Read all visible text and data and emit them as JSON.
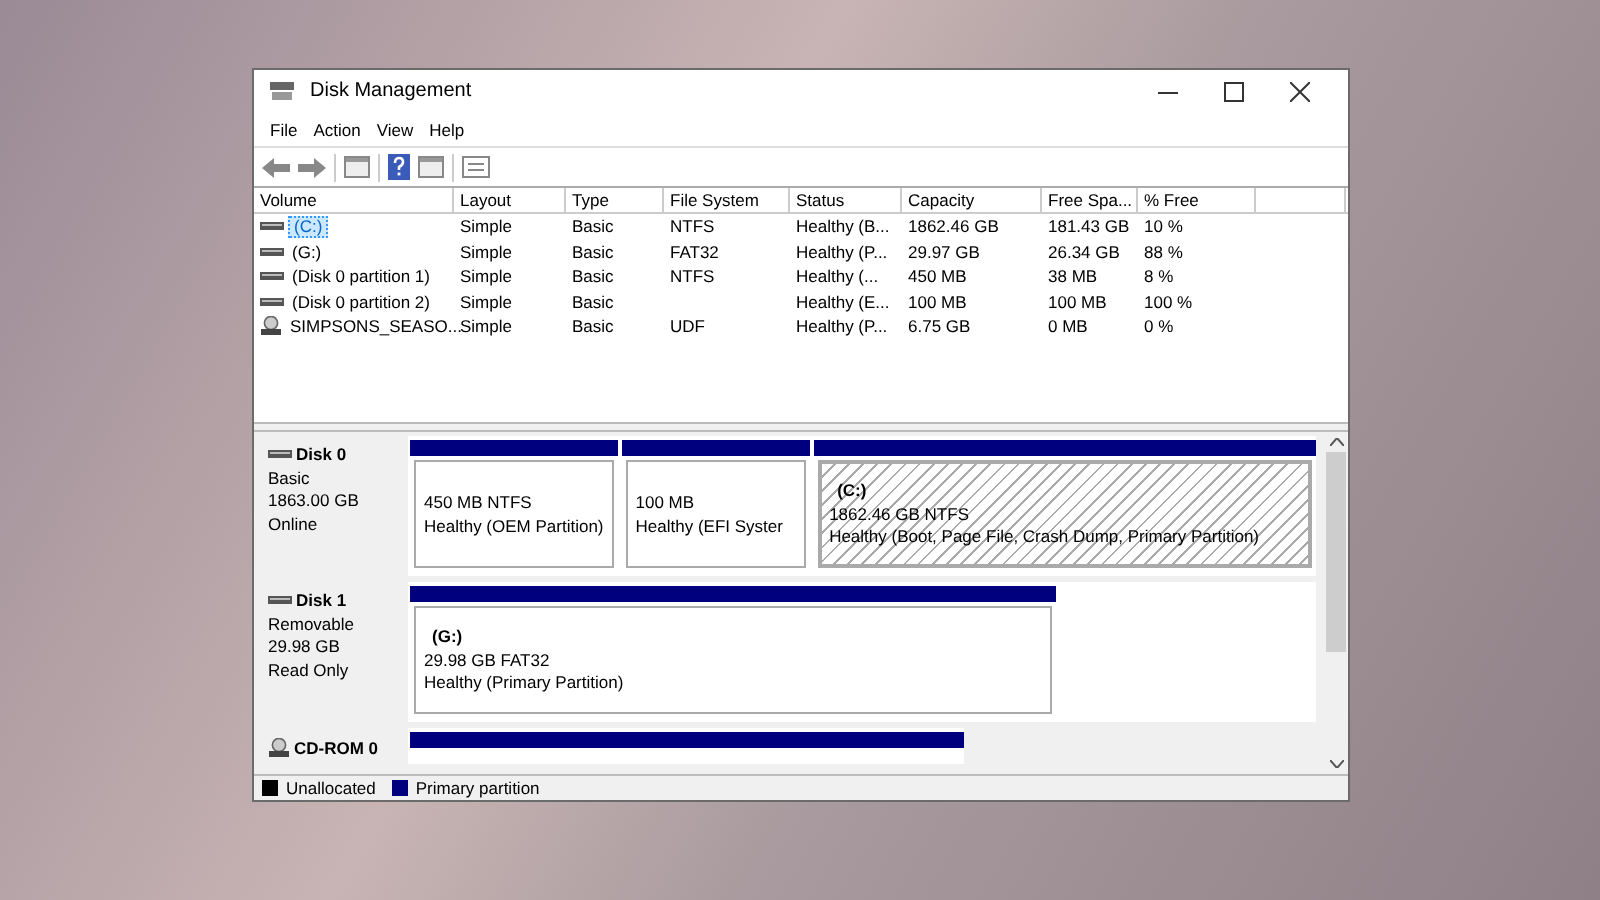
{
  "window": {
    "title": "Disk Management"
  },
  "menu": [
    "File",
    "Action",
    "View",
    "Help"
  ],
  "table": {
    "columns": [
      "Volume",
      "Layout",
      "Type",
      "File System",
      "Status",
      "Capacity",
      "Free Spa...",
      "% Free"
    ],
    "rows": [
      {
        "kind": "disk",
        "selected": true,
        "cells": [
          "(C:)",
          "Simple",
          "Basic",
          "NTFS",
          "Healthy (B...",
          "1862.46 GB",
          "181.43 GB",
          "10 %"
        ]
      },
      {
        "kind": "disk",
        "selected": false,
        "cells": [
          "(G:)",
          "Simple",
          "Basic",
          "FAT32",
          "Healthy (P...",
          "29.97 GB",
          "26.34 GB",
          "88 %"
        ]
      },
      {
        "kind": "disk",
        "selected": false,
        "cells": [
          "(Disk 0 partition 1)",
          "Simple",
          "Basic",
          "NTFS",
          "Healthy (...",
          "450 MB",
          "38 MB",
          "8 %"
        ]
      },
      {
        "kind": "disk",
        "selected": false,
        "cells": [
          "(Disk 0 partition 2)",
          "Simple",
          "Basic",
          "",
          "Healthy (E...",
          "100 MB",
          "100 MB",
          "100 %"
        ]
      },
      {
        "kind": "optical",
        "selected": false,
        "cells": [
          "SIMPSONS_SEASO...",
          "Simple",
          "Basic",
          "UDF",
          "Healthy (P...",
          "6.75 GB",
          "0 MB",
          "0 %"
        ]
      }
    ]
  },
  "disks": [
    {
      "kind": "disk",
      "name": "Disk 0",
      "lines": [
        "Basic",
        "1863.00 GB",
        "Online"
      ],
      "partitions": [
        {
          "selected": false,
          "lines": [
            "450 MB NTFS",
            "Healthy (OEM Partition)"
          ]
        },
        {
          "selected": false,
          "lines": [
            "100 MB",
            "Healthy (EFI Syster"
          ]
        },
        {
          "selected": true,
          "label": "(C:)",
          "lines": [
            "1862.46 GB NTFS",
            "Healthy (Boot, Page File, Crash Dump, Primary Partition)"
          ]
        }
      ]
    },
    {
      "kind": "disk",
      "name": "Disk 1",
      "lines": [
        "Removable",
        "29.98 GB",
        "Read Only"
      ],
      "partitions": [
        {
          "selected": false,
          "label": "(G:)",
          "lines": [
            "29.98 GB FAT32",
            "Healthy (Primary Partition)"
          ]
        }
      ]
    },
    {
      "kind": "optical",
      "name": "CD-ROM 0"
    }
  ],
  "legend": [
    {
      "label": "Unallocated",
      "color": "#000000"
    },
    {
      "label": "Primary partition",
      "color": "#00007f"
    }
  ]
}
